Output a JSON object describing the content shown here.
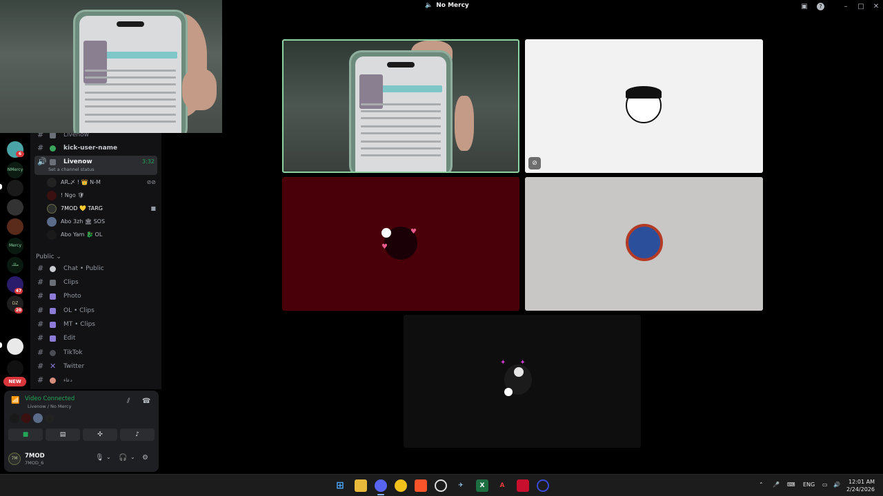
{
  "window": {
    "title": "No Mercy",
    "controls": [
      "screen-icon",
      "help-icon",
      "minimize-icon",
      "maximize-icon",
      "close-icon"
    ]
  },
  "sidebar": {
    "badges": {
      "first": "6",
      "second": "47",
      "third": "20",
      "new": "NEW"
    },
    "channels": [
      {
        "label": "Livenow",
        "icon": "speaker-icon",
        "type": "voice"
      },
      {
        "label": "kick-user-name",
        "icon": "green-dot",
        "type": "text"
      },
      {
        "label": "Livenow",
        "icon": "speaker-icon",
        "type": "voice",
        "selected": true,
        "time": "3:32",
        "status": "Set a channel status"
      }
    ],
    "voice_users": [
      {
        "name": "ARـ〆 !  👑 N-M"
      },
      {
        "name": "! Ngo 🛡"
      },
      {
        "name": "7MOD 💛 TARG"
      },
      {
        "name": "Abo 3zh 🏛 SOS"
      },
      {
        "name": "Abo Yam 🐉 OL"
      }
    ],
    "category": "Public",
    "public_channels": [
      {
        "label": "Chat • Public"
      },
      {
        "label": "Clips"
      },
      {
        "label": "Photo"
      },
      {
        "label": "OL • Clips"
      },
      {
        "label": "MT • Clips"
      },
      {
        "label": "Edit"
      },
      {
        "label": "TikTok"
      },
      {
        "label": "Twitter"
      },
      {
        "label": "دعاء"
      }
    ]
  },
  "voice_panel": {
    "status": "Video Connected",
    "location": "Livenow / No Mercy",
    "buttons": [
      "camera-icon",
      "screen-share-icon",
      "activities-icon",
      "soundboard-icon"
    ]
  },
  "user": {
    "name": "7MOD",
    "tag": "7MOD_6",
    "avatar_text": "7M"
  },
  "taskbar": {
    "language": "ENG",
    "time": "12:01 AM",
    "date": "2/24/2026"
  },
  "colors": {
    "connected": "#23a55a",
    "active_tile_border": "#8fd3a5",
    "badge": "#da373c",
    "tile3_bg": "#4a0009"
  }
}
